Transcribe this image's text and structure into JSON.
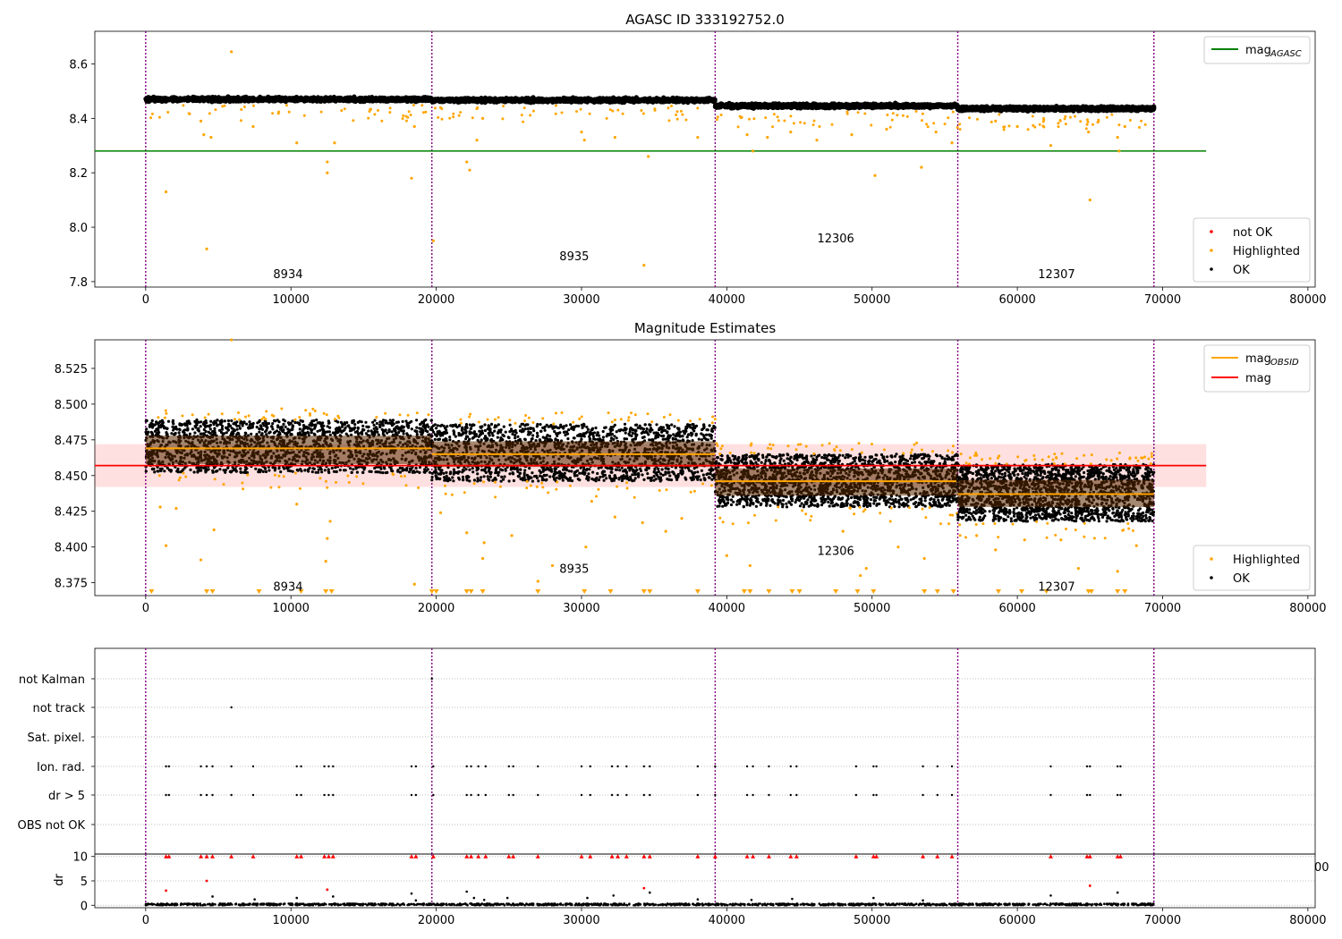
{
  "chart_data": [
    {
      "type": "scatter",
      "title": "AGASC ID 333192752.0",
      "xlim": [
        -3500,
        80500
      ],
      "ylim": [
        7.78,
        8.72
      ],
      "xticks": [
        0,
        10000,
        20000,
        30000,
        40000,
        50000,
        60000,
        70000,
        80000
      ],
      "yticks": [
        7.8,
        8.0,
        8.2,
        8.4,
        8.6
      ],
      "obsid_boundaries": [
        0,
        19700,
        39200,
        55900,
        69400
      ],
      "obsid_labels": [
        {
          "text": "8934",
          "x": 9800,
          "y": 7.83
        },
        {
          "text": "8935",
          "x": 29500,
          "y": 7.895
        },
        {
          "text": "12306",
          "x": 47500,
          "y": 7.96
        },
        {
          "text": "12307",
          "x": 62700,
          "y": 7.83
        }
      ],
      "segments": [
        {
          "x0": 0,
          "x1": 19700,
          "mean": 8.47,
          "spread": 0.012
        },
        {
          "x0": 19700,
          "x1": 39200,
          "mean": 8.467,
          "spread": 0.012
        },
        {
          "x0": 39200,
          "x1": 55900,
          "mean": 8.446,
          "spread": 0.012
        },
        {
          "x0": 55900,
          "x1": 69400,
          "mean": 8.436,
          "spread": 0.012
        }
      ],
      "agasc_mag": 8.28,
      "agasc_line_x": [
        -3500,
        73000
      ],
      "highlighted_outliers": [
        [
          1400,
          8.13
        ],
        [
          4200,
          7.92
        ],
        [
          5900,
          8.645
        ],
        [
          4000,
          8.34
        ],
        [
          4500,
          8.33
        ],
        [
          3800,
          8.39
        ],
        [
          7400,
          8.37
        ],
        [
          10400,
          8.31
        ],
        [
          12500,
          8.24
        ],
        [
          12500,
          8.2
        ],
        [
          13000,
          8.31
        ],
        [
          18300,
          8.18
        ],
        [
          18500,
          8.37
        ],
        [
          19800,
          7.95
        ],
        [
          22100,
          8.24
        ],
        [
          22300,
          8.21
        ],
        [
          22800,
          8.32
        ],
        [
          23200,
          8.4
        ],
        [
          30000,
          8.35
        ],
        [
          30200,
          8.32
        ],
        [
          32300,
          8.33
        ],
        [
          34300,
          7.86
        ],
        [
          34600,
          8.26
        ],
        [
          38000,
          8.33
        ],
        [
          41400,
          8.34
        ],
        [
          41800,
          8.28
        ],
        [
          42800,
          8.33
        ],
        [
          44400,
          8.35
        ],
        [
          46200,
          8.32
        ],
        [
          48600,
          8.34
        ],
        [
          50200,
          8.19
        ],
        [
          51000,
          8.36
        ],
        [
          53400,
          8.22
        ],
        [
          54400,
          8.35
        ],
        [
          55500,
          8.31
        ],
        [
          62300,
          8.3
        ],
        [
          64900,
          8.35
        ],
        [
          65000,
          8.1
        ],
        [
          66900,
          8.33
        ],
        [
          67000,
          8.28
        ],
        [
          67400,
          8.37
        ],
        [
          60000,
          8.37
        ],
        [
          58500,
          8.39
        ]
      ],
      "legend_lines": [
        {
          "label": "mag",
          "sub": "AGASC",
          "color": "#008000"
        }
      ],
      "legend_points": [
        {
          "label": "not OK",
          "color": "#ff0000"
        },
        {
          "label": "Highlighted",
          "color": "#ffa500"
        },
        {
          "label": "OK",
          "color": "#000000"
        }
      ]
    },
    {
      "type": "scatter",
      "title": "Magnitude Estimates",
      "xlim": [
        -3500,
        80500
      ],
      "ylim": [
        8.366,
        8.545
      ],
      "xticks": [
        0,
        10000,
        20000,
        30000,
        40000,
        50000,
        60000,
        70000,
        80000
      ],
      "yticks": [
        8.375,
        8.4,
        8.425,
        8.45,
        8.475,
        8.5,
        8.525
      ],
      "obsid_boundaries": [
        0,
        19700,
        39200,
        55900,
        69400
      ],
      "obsid_labels": [
        {
          "text": "8934",
          "x": 9800,
          "y": 8.3725
        },
        {
          "text": "8935",
          "x": 29500,
          "y": 8.385
        },
        {
          "text": "12306",
          "x": 47500,
          "y": 8.3975
        },
        {
          "text": "12307",
          "x": 62700,
          "y": 8.3725
        }
      ],
      "segments": [
        {
          "x0": 0,
          "x1": 19700,
          "mean": 8.469,
          "lo": 8.452,
          "hi": 8.489,
          "band_lo": 8.458,
          "band_hi": 8.478
        },
        {
          "x0": 19700,
          "x1": 39200,
          "mean": 8.465,
          "lo": 8.446,
          "hi": 8.486,
          "band_lo": 8.456,
          "band_hi": 8.474
        },
        {
          "x0": 39200,
          "x1": 55900,
          "mean": 8.446,
          "lo": 8.428,
          "hi": 8.465,
          "band_lo": 8.436,
          "band_hi": 8.455
        },
        {
          "x0": 55900,
          "x1": 69400,
          "mean": 8.437,
          "lo": 8.418,
          "hi": 8.458,
          "band_lo": 8.428,
          "band_hi": 8.447
        }
      ],
      "mag": 8.457,
      "mag_band": [
        8.442,
        8.472
      ],
      "mag_line_x": [
        -3500,
        73000
      ],
      "below_range_markers": [
        400,
        4200,
        4600,
        7800,
        10700,
        12400,
        12800,
        19700,
        20000,
        22100,
        22400,
        23200,
        27000,
        30200,
        32000,
        34300,
        34700,
        38000,
        41200,
        41600,
        42900,
        44500,
        45000,
        47500,
        49000,
        50100,
        53600,
        54500,
        55600,
        58700,
        60300,
        62000,
        64900,
        65100,
        66900,
        67400
      ],
      "highlighted_outliers": [
        [
          5900,
          8.545
        ],
        [
          1000,
          8.428
        ],
        [
          1400,
          8.401
        ],
        [
          2100,
          8.427
        ],
        [
          3800,
          8.391
        ],
        [
          4700,
          8.412
        ],
        [
          10400,
          8.43
        ],
        [
          12400,
          8.39
        ],
        [
          12500,
          8.406
        ],
        [
          12700,
          8.418
        ],
        [
          18500,
          8.374
        ],
        [
          20300,
          8.424
        ],
        [
          22100,
          8.41
        ],
        [
          23200,
          8.392
        ],
        [
          23300,
          8.403
        ],
        [
          25200,
          8.408
        ],
        [
          27000,
          8.376
        ],
        [
          28000,
          8.387
        ],
        [
          30300,
          8.4
        ],
        [
          30700,
          8.432
        ],
        [
          32300,
          8.421
        ],
        [
          34200,
          8.417
        ],
        [
          35800,
          8.411
        ],
        [
          36900,
          8.42
        ],
        [
          40000,
          8.394
        ],
        [
          41600,
          8.387
        ],
        [
          48000,
          8.411
        ],
        [
          49200,
          8.38
        ],
        [
          49600,
          8.385
        ],
        [
          51800,
          8.4
        ],
        [
          53600,
          8.392
        ],
        [
          57200,
          8.408
        ],
        [
          58500,
          8.398
        ],
        [
          60500,
          8.405
        ],
        [
          63000,
          8.405
        ],
        [
          64200,
          8.385
        ],
        [
          66900,
          8.383
        ],
        [
          68200,
          8.401
        ]
      ],
      "legend_lines": [
        {
          "label": "mag",
          "sub": "OBSID",
          "color": "#ffa500"
        },
        {
          "label": "mag",
          "sub": "",
          "color": "#ff0000"
        }
      ],
      "legend_points": [
        {
          "label": "Highlighted",
          "color": "#ffa500"
        },
        {
          "label": "OK",
          "color": "#000000"
        }
      ]
    },
    {
      "type": "scatter",
      "title": "",
      "xlim": [
        -3500,
        80500
      ],
      "flag_rows": [
        "not Kalman",
        "not track",
        "Sat. pixel.",
        "Ion. rad.",
        "dr > 5",
        "OBS not OK"
      ],
      "obsid_boundaries": [
        0,
        19700,
        39200,
        55900,
        69400
      ],
      "flag_points": {
        "not Kalman": [
          19700
        ],
        "not track": [
          5900
        ],
        "Sat. pixel.": [],
        "Ion. rad.": [
          1400,
          1600,
          3800,
          4200,
          4600,
          5900,
          7400,
          10400,
          10700,
          12300,
          12600,
          12900,
          18300,
          18600,
          19800,
          22100,
          22400,
          22900,
          23400,
          25000,
          25300,
          27000,
          30000,
          30600,
          32100,
          32500,
          33100,
          34300,
          34700,
          38000,
          39200,
          41400,
          41800,
          42900,
          44400,
          44800,
          48900,
          50100,
          50300,
          53500,
          54500,
          55500,
          62300,
          64800,
          65000,
          66900,
          67100
        ],
        "dr > 5": [
          1400,
          1600,
          3800,
          4200,
          4600,
          5900,
          7400,
          10400,
          10700,
          12300,
          12600,
          12900,
          18300,
          18600,
          19800,
          22100,
          22400,
          22900,
          23400,
          25000,
          25300,
          27000,
          30000,
          30600,
          32100,
          32500,
          33100,
          34300,
          34700,
          38000,
          39200,
          41400,
          41800,
          42900,
          44400,
          44800,
          48900,
          50100,
          50300,
          53500,
          54500,
          55500,
          62300,
          64800,
          65000,
          66900,
          67100
        ],
        "OBS not OK": []
      }
    },
    {
      "type": "scatter",
      "ylabel": "dr",
      "xlim": [
        -3500,
        80500
      ],
      "ylim": [
        -0.5,
        10.5
      ],
      "xticks": [
        0,
        10000,
        20000,
        30000,
        40000,
        50000,
        60000,
        70000,
        80000
      ],
      "yticks": [
        0,
        5,
        10
      ],
      "clipped_marker_x": [
        1400,
        1600,
        3800,
        4200,
        4600,
        5900,
        7400,
        10400,
        10700,
        12300,
        12600,
        12900,
        18300,
        18600,
        19800,
        22100,
        22400,
        22900,
        23400,
        25000,
        25300,
        27000,
        30000,
        30600,
        32100,
        32500,
        33100,
        34300,
        34700,
        38000,
        39200,
        41400,
        41800,
        42900,
        44400,
        44800,
        48900,
        50100,
        50300,
        53500,
        54500,
        55500,
        62300,
        64800,
        65000,
        66900,
        67100
      ],
      "red_points": [
        [
          1400,
          3.0
        ],
        [
          4200,
          5.0
        ],
        [
          12500,
          3.2
        ],
        [
          34300,
          3.5
        ],
        [
          65000,
          4.0
        ]
      ],
      "black_outliers": [
        [
          4600,
          1.8
        ],
        [
          7500,
          1.2
        ],
        [
          10400,
          1.5
        ],
        [
          12900,
          1.8
        ],
        [
          18300,
          2.4
        ],
        [
          18600,
          1.0
        ],
        [
          22100,
          2.8
        ],
        [
          22600,
          1.5
        ],
        [
          23300,
          1.1
        ],
        [
          24900,
          1.5
        ],
        [
          30400,
          1.5
        ],
        [
          32200,
          2.0
        ],
        [
          34700,
          2.6
        ],
        [
          38000,
          1.2
        ],
        [
          41700,
          1.1
        ],
        [
          44500,
          1.3
        ],
        [
          50100,
          1.5
        ],
        [
          53500,
          1.0
        ],
        [
          62300,
          2.0
        ],
        [
          66900,
          2.6
        ]
      ],
      "overflow_tick_text": "00"
    }
  ]
}
